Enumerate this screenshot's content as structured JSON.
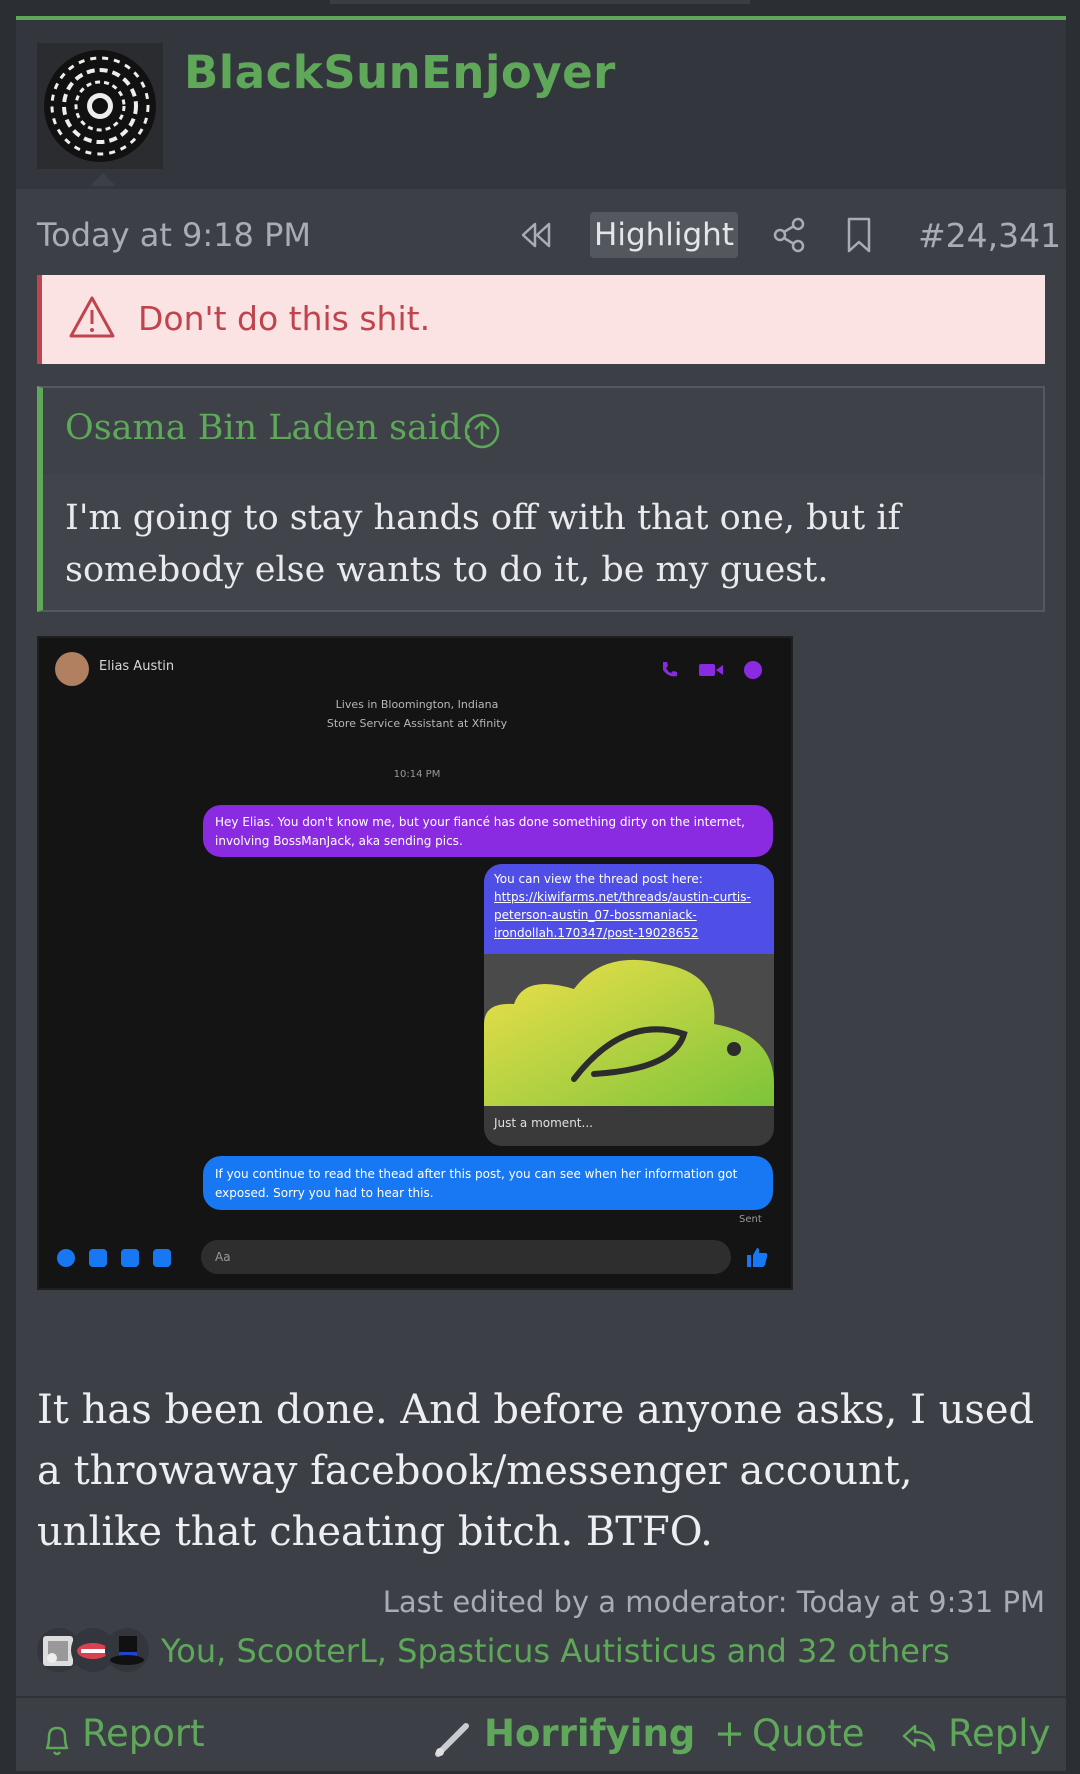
{
  "post": {
    "username": "BlackSunEnjoyer",
    "date": "Today at 9:18 PM",
    "highlight_label": "Highlight",
    "post_number": "#24,341",
    "warning": "Don't do this shit.",
    "quote": {
      "author": "Osama Bin Laden said:",
      "text": "I'm going to stay hands off with that one, but if somebody else wants to do it, be my guest."
    },
    "screenshot": {
      "contact_name": "Elias Austin",
      "lives": "Lives in Bloomington, Indiana",
      "job": "Store Service Assistant at Xfinity",
      "time": "10:14 PM",
      "message1": "Hey Elias. You don't know me, but your fiancé has done something dirty on the internet, involving BossManJack, aka sending pics.",
      "message2_intro": "You can view the thread post here:",
      "message2_link": "https://kiwifarms.net/threads/austin-curtis-peterson-austin_07-bossmaniack-irondollah.170347/post-19028652",
      "card_caption": "Just a moment...",
      "message3": "If you continue to read the thead after this post, you can see when her information got exposed. Sorry you had to hear this.",
      "sent": "Sent",
      "input_placeholder": "Aa"
    },
    "body": "It has been done. And before anyone asks, I used a throwaway facebook/messenger account, unlike that cheating bitch. BTFO.",
    "edited": "Last edited by a moderator: Today at 9:31 PM",
    "reactions_text": "You, ScooterL, Spasticus Autisticus and 32 others",
    "footer": {
      "report": "Report",
      "reaction": "Horrifying",
      "quote": "Quote",
      "reply": "Reply"
    }
  },
  "colors": {
    "accent": "#5fa85a",
    "warning_text": "#c0444d",
    "warning_bg": "#fbe3e3",
    "post_bg": "#3c3f46",
    "messenger_purple": "#8a2be2",
    "messenger_blue": "#1877f2"
  }
}
